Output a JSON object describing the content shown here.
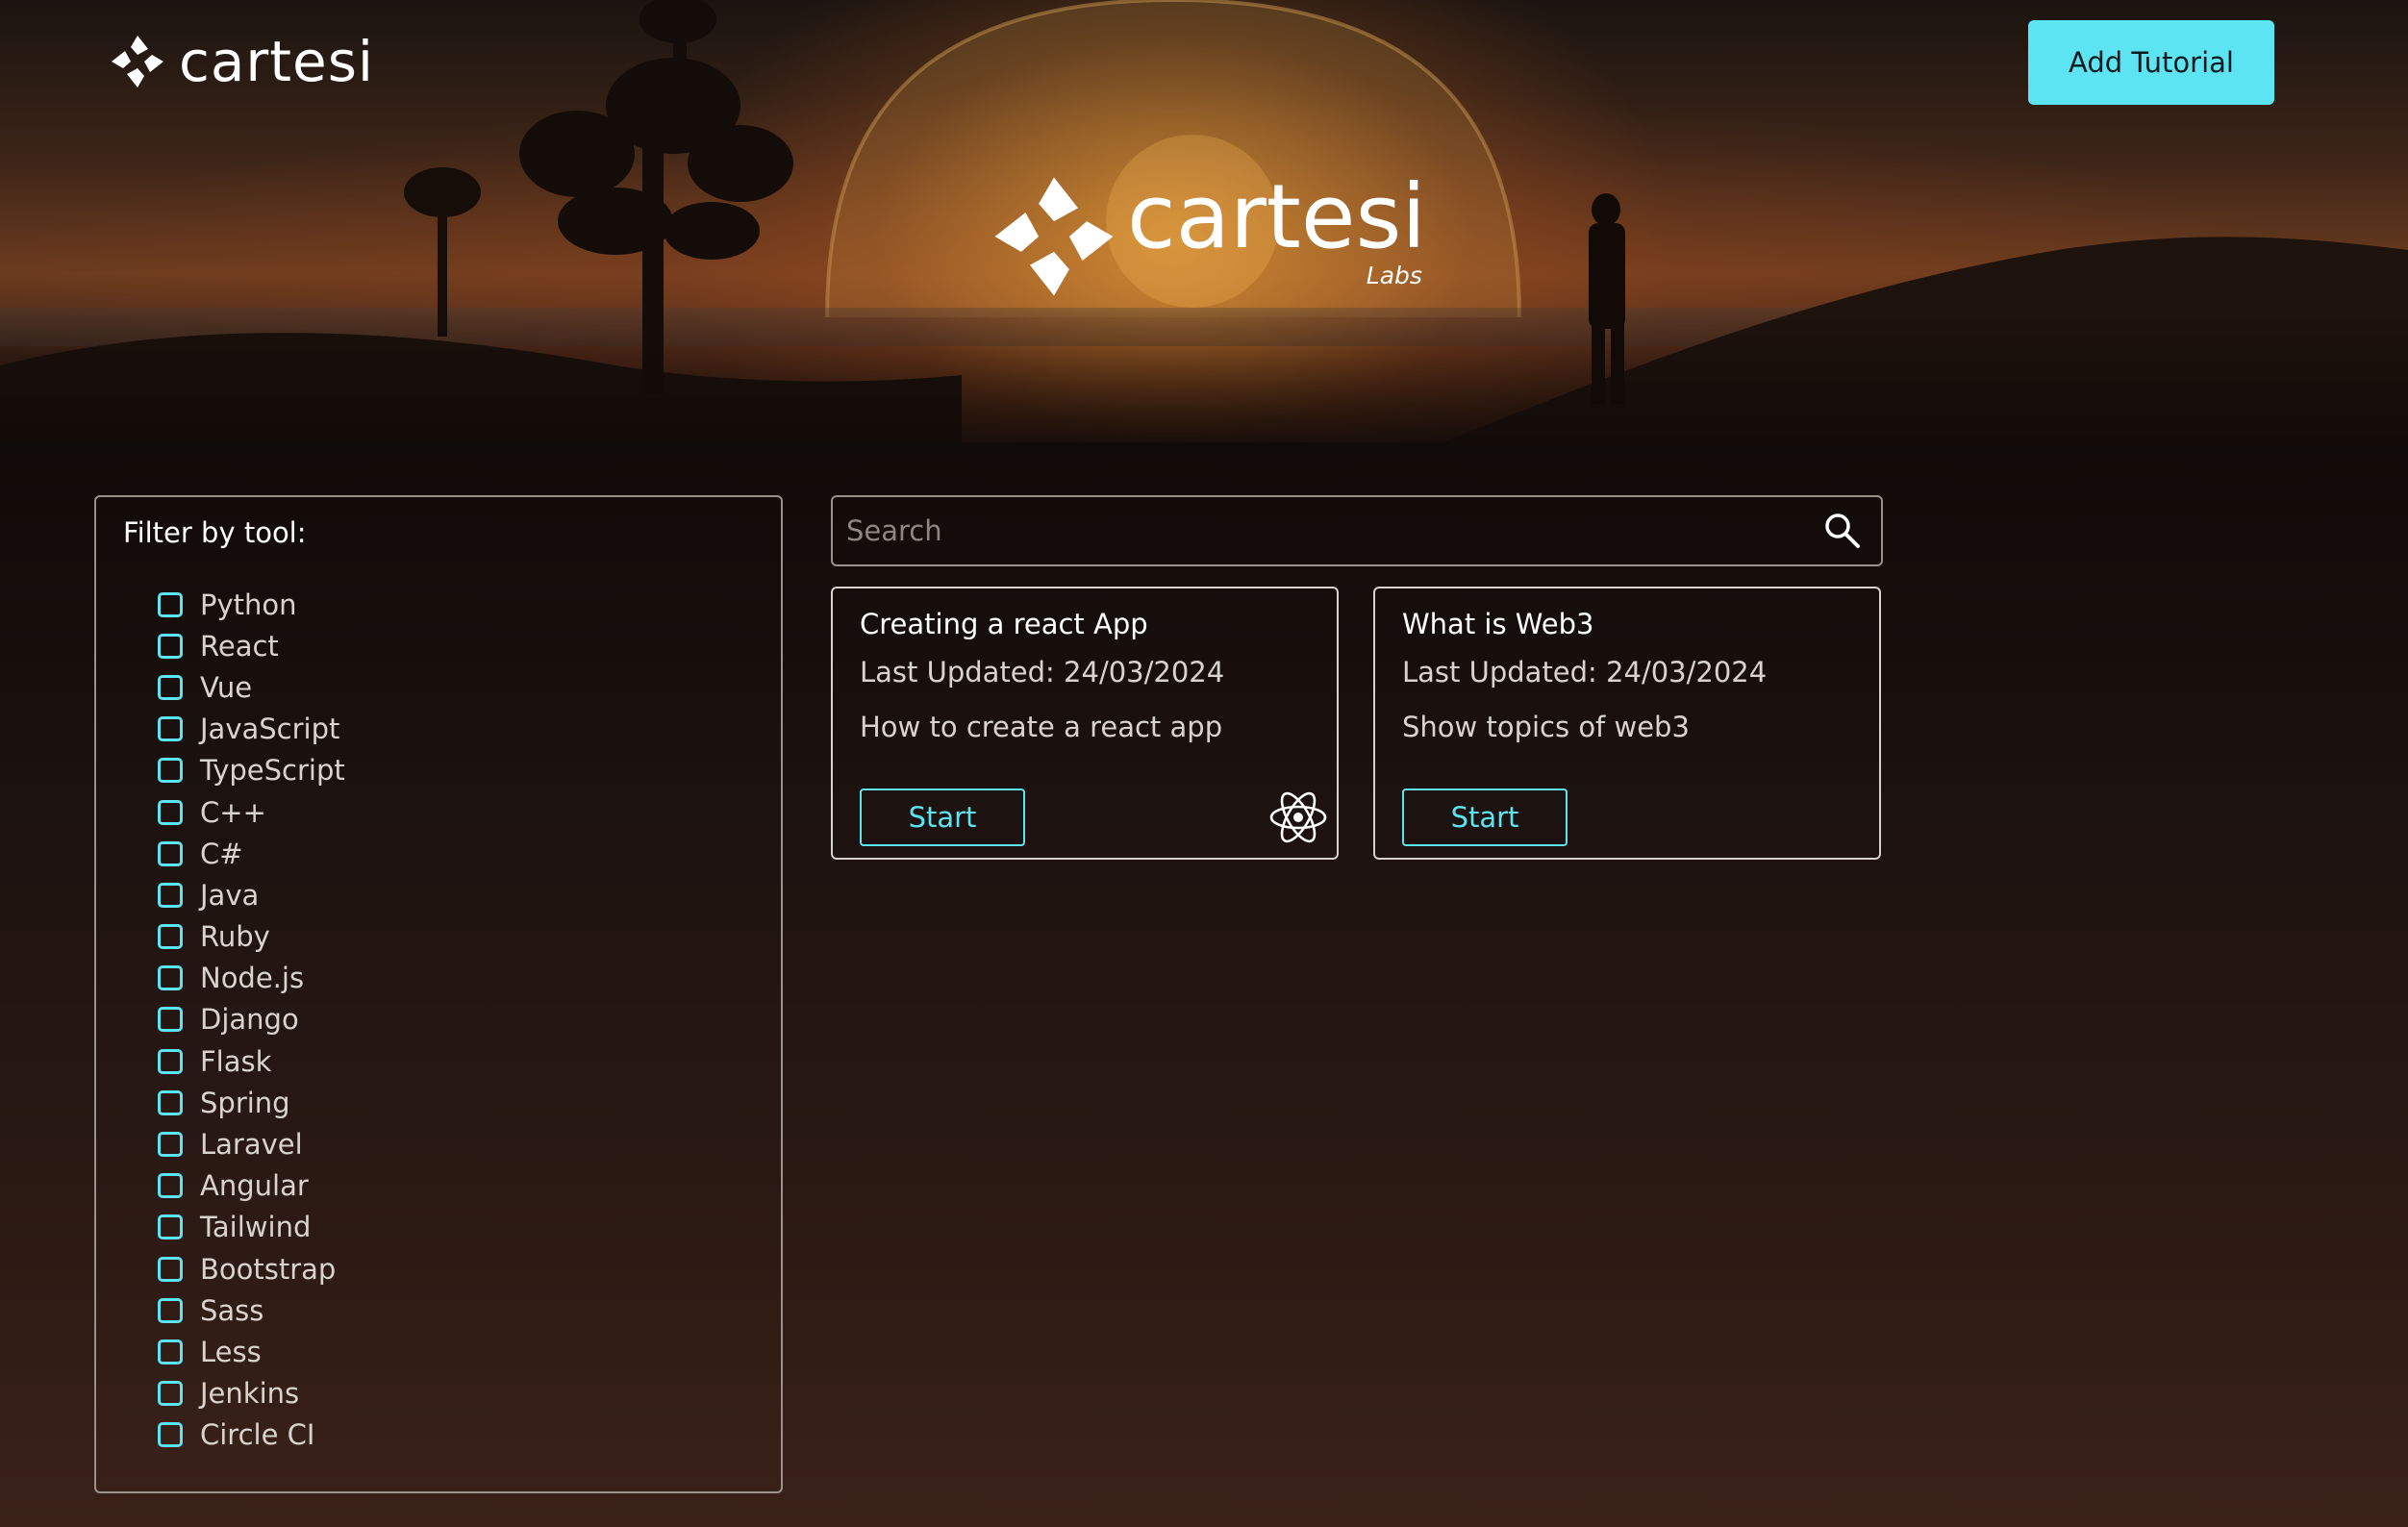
{
  "header": {
    "brand_name": "cartesi",
    "add_tutorial_label": "Add Tutorial"
  },
  "hero": {
    "brand_name": "cartesi",
    "brand_sub": "Labs"
  },
  "filter": {
    "title": "Filter by tool:",
    "tools": [
      "Python",
      "React",
      "Vue",
      "JavaScript",
      "TypeScript",
      "C++",
      "C#",
      "Java",
      "Ruby",
      "Node.js",
      "Django",
      "Flask",
      "Spring",
      "Laravel",
      "Angular",
      "Tailwind",
      "Bootstrap",
      "Sass",
      "Less",
      "Jenkins",
      "Circle CI"
    ]
  },
  "search": {
    "placeholder": "Search",
    "icon": "search-icon"
  },
  "tutorials": [
    {
      "title": "Creating a react App",
      "last_updated": "Last Updated: 24/03/2024",
      "description": "How to create a react app",
      "start_label": "Start",
      "icon": "react-icon"
    },
    {
      "title": "What is Web3",
      "last_updated": "Last Updated: 24/03/2024",
      "description": "Show topics of web3",
      "start_label": "Start"
    }
  ],
  "colors": {
    "accent": "#5ce4f2",
    "background": "#1a110d",
    "border": "#9a918c"
  }
}
